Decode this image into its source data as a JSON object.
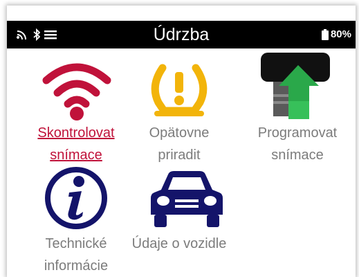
{
  "header": {
    "title": "Údrzba",
    "battery": "80%",
    "icons": [
      "wifi-icon",
      "bluetooth-icon",
      "menu-icon"
    ]
  },
  "tiles": [
    {
      "line1": "Skontrolovat",
      "line2": "snímace",
      "icon": "wifi-signal-icon",
      "active": true
    },
    {
      "line1": "Opätovne",
      "line2": "priradit",
      "icon": "tpms-warning-icon"
    },
    {
      "line1": "Programovat",
      "line2": "snímace",
      "icon": "sensor-program-icon"
    },
    {
      "line1": "Technické",
      "line2": "informácie",
      "icon": "info-icon"
    },
    {
      "line1": "Údaje o vozidle",
      "line2": "",
      "icon": "car-icon"
    }
  ],
  "colors": {
    "active": "#c0123a",
    "warning": "#f2b40a",
    "navy": "#14146a",
    "green": "#2aa84a"
  }
}
